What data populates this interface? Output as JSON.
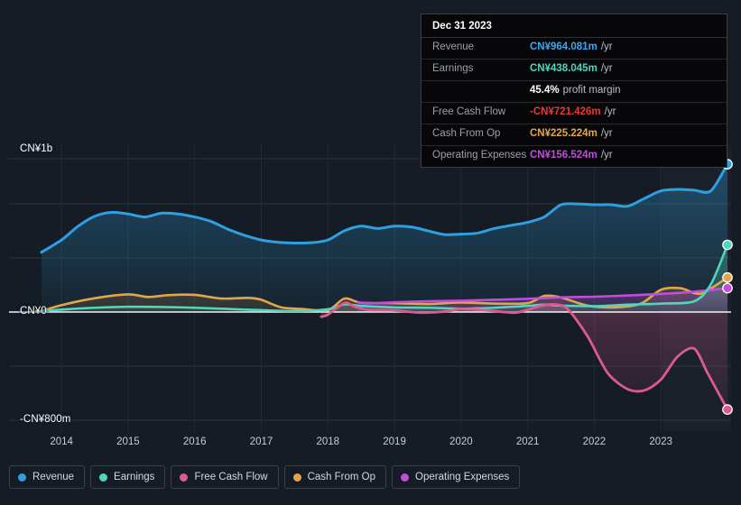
{
  "chart_data": {
    "type": "area",
    "title": "",
    "xlabel": "",
    "ylabel": "",
    "currency": "CN¥",
    "x_ticks": [
      "2014",
      "2015",
      "2016",
      "2017",
      "2018",
      "2019",
      "2020",
      "2021",
      "2022",
      "2023"
    ],
    "y_ticks": [
      "CN¥1b",
      "CN¥0",
      "-CN¥800m"
    ],
    "ylim": [
      -800,
      1000
    ],
    "y_unit": "millions CN¥",
    "grid": true,
    "legend_position": "bottom-left",
    "x_range": [
      "2013-09",
      "2024-01"
    ],
    "series": [
      {
        "name": "Revenue",
        "color": "#2f9fe0",
        "fill": true,
        "x": [
          2013.7,
          2014.0,
          2014.25,
          2014.5,
          2014.75,
          2015.0,
          2015.25,
          2015.5,
          2015.75,
          2016.0,
          2016.25,
          2016.5,
          2016.75,
          2017.0,
          2017.25,
          2017.5,
          2017.75,
          2018.0,
          2018.25,
          2018.5,
          2018.75,
          2019.0,
          2019.25,
          2019.5,
          2019.75,
          2020.0,
          2020.25,
          2020.5,
          2020.75,
          2021.0,
          2021.25,
          2021.5,
          2021.75,
          2022.0,
          2022.25,
          2022.5,
          2022.75,
          2023.0,
          2023.25,
          2023.5,
          2023.75,
          2024.0
        ],
        "values": [
          390,
          470,
          560,
          625,
          650,
          640,
          620,
          645,
          640,
          620,
          590,
          540,
          500,
          470,
          455,
          450,
          452,
          470,
          530,
          560,
          545,
          560,
          555,
          530,
          505,
          508,
          515,
          545,
          565,
          585,
          620,
          700,
          705,
          700,
          700,
          690,
          740,
          790,
          800,
          795,
          790,
          964
        ]
      },
      {
        "name": "Earnings",
        "color": "#4fd6bc",
        "fill": true,
        "x": [
          2013.7,
          2014.0,
          2014.5,
          2015.0,
          2015.5,
          2016.0,
          2016.5,
          2017.0,
          2017.5,
          2018.0,
          2018.25,
          2018.5,
          2019.0,
          2019.5,
          2020.0,
          2020.5,
          2021.0,
          2021.25,
          2021.5,
          2022.0,
          2022.5,
          2023.0,
          2023.5,
          2023.75,
          2024.0
        ],
        "values": [
          4,
          16,
          28,
          34,
          33,
          28,
          20,
          12,
          6,
          18,
          50,
          40,
          30,
          28,
          22,
          28,
          40,
          48,
          42,
          38,
          48,
          55,
          70,
          180,
          438
        ]
      },
      {
        "name": "Free Cash Flow",
        "color": "#dd5a8f",
        "fill": true,
        "start_x": 2017.9,
        "x": [
          2017.9,
          2018.0,
          2018.25,
          2018.4,
          2018.6,
          2019.0,
          2019.4,
          2019.8,
          2020.0,
          2020.4,
          2020.8,
          2021.0,
          2021.2,
          2021.4,
          2021.6,
          2021.9,
          2022.2,
          2022.5,
          2022.75,
          2023.0,
          2023.25,
          2023.5,
          2023.7,
          2024.0
        ],
        "values": [
          -35,
          -20,
          60,
          35,
          15,
          10,
          -5,
          5,
          20,
          10,
          -5,
          15,
          40,
          50,
          20,
          -180,
          -450,
          -570,
          -580,
          -500,
          -330,
          -270,
          -450,
          -721
        ]
      },
      {
        "name": "Cash From Op",
        "color": "#e2a64a",
        "fill": true,
        "x": [
          2013.7,
          2014.0,
          2014.5,
          2015.0,
          2015.3,
          2015.6,
          2016.0,
          2016.4,
          2016.8,
          2017.0,
          2017.3,
          2017.6,
          2018.0,
          2018.25,
          2018.5,
          2019.0,
          2019.5,
          2020.0,
          2020.5,
          2021.0,
          2021.25,
          2021.5,
          2021.9,
          2022.3,
          2022.7,
          2023.0,
          2023.3,
          2023.6,
          2024.0
        ],
        "values": [
          6,
          45,
          90,
          115,
          98,
          110,
          112,
          88,
          92,
          80,
          30,
          20,
          12,
          88,
          60,
          58,
          52,
          62,
          55,
          58,
          105,
          95,
          42,
          30,
          55,
          145,
          155,
          120,
          225
        ]
      },
      {
        "name": "Operating Expenses",
        "color": "#c14ddd",
        "fill": true,
        "start_x": 2018.45,
        "x": [
          2018.45,
          2018.7,
          2019.0,
          2019.5,
          2020.0,
          2020.5,
          2021.0,
          2021.5,
          2022.0,
          2022.5,
          2023.0,
          2023.5,
          2024.0
        ],
        "values": [
          62,
          58,
          64,
          70,
          74,
          80,
          86,
          96,
          100,
          108,
          118,
          132,
          156
        ]
      }
    ]
  },
  "tooltip": {
    "title": "Dec 31 2023",
    "rows": [
      {
        "label": "Revenue",
        "value": "CN¥964.081m",
        "suffix": "/yr",
        "color": "#3aa7ee"
      },
      {
        "label": "Earnings",
        "value": "CN¥438.045m",
        "suffix": "/yr",
        "color": "#4fd6bc"
      },
      {
        "label": "",
        "value": "45.4%",
        "suffix": "profit margin",
        "color": "#ffffff"
      },
      {
        "label": "Free Cash Flow",
        "value": "-CN¥721.426m",
        "suffix": "/yr",
        "color": "#e53935"
      },
      {
        "label": "Cash From Op",
        "value": "CN¥225.224m",
        "suffix": "/yr",
        "color": "#e2a64a"
      },
      {
        "label": "Operating Expenses",
        "value": "CN¥156.524m",
        "suffix": "/yr",
        "color": "#c14ddd"
      }
    ]
  },
  "legend": {
    "items": [
      {
        "label": "Revenue",
        "color": "#2f9fe0"
      },
      {
        "label": "Earnings",
        "color": "#4fd6bc"
      },
      {
        "label": "Free Cash Flow",
        "color": "#dd5a8f"
      },
      {
        "label": "Cash From Op",
        "color": "#e2a64a"
      },
      {
        "label": "Operating Expenses",
        "color": "#c14ddd"
      }
    ]
  },
  "axes": {
    "y_top": "CN¥1b",
    "y_zero": "CN¥0",
    "y_bottom": "-CN¥800m"
  }
}
